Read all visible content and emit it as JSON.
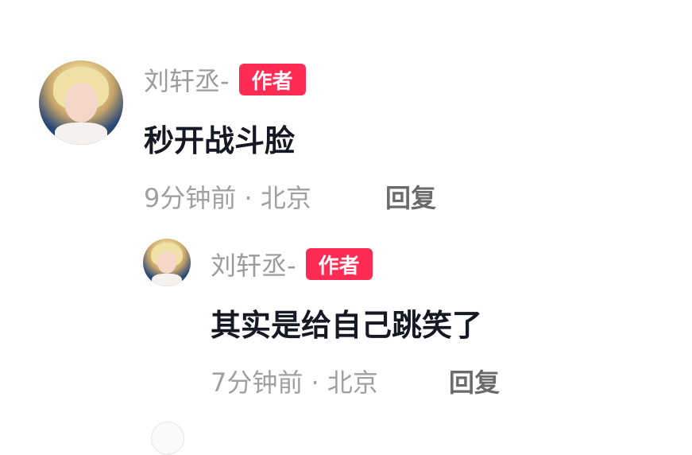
{
  "comments": [
    {
      "username": "刘轩丞-",
      "badge": "作者",
      "text": "秒开战斗脸",
      "meta": "9分钟前 · 北京",
      "reply": "回复"
    },
    {
      "username": "刘轩丞-",
      "badge": "作者",
      "text": "其实是给自己跳笑了",
      "meta": "7分钟前 · 北京",
      "reply": "回复"
    }
  ],
  "colors": {
    "badge": "#fe2c55",
    "username": "#9b9b9b",
    "content": "#161823",
    "meta": "#a0a0a0",
    "reply": "#6b6b6b"
  }
}
